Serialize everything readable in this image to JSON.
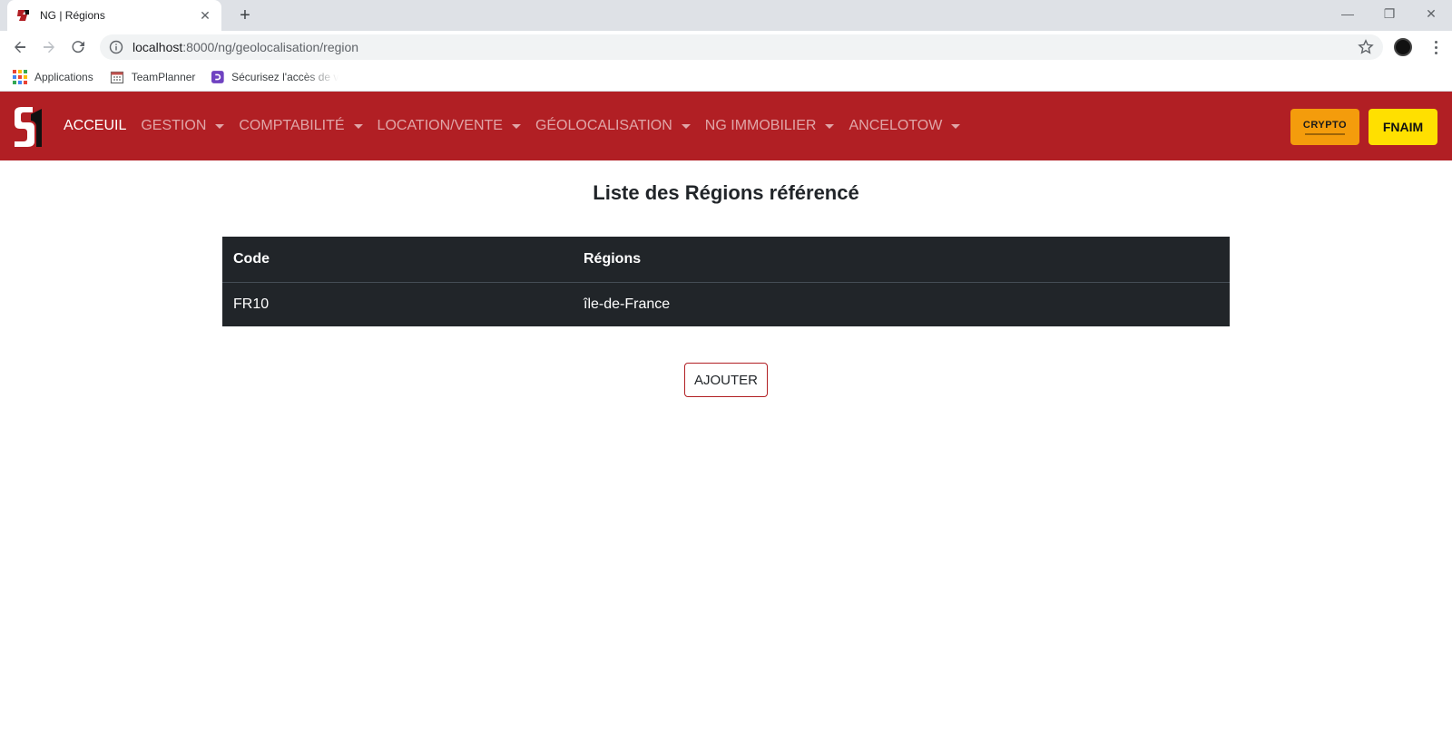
{
  "browser": {
    "tab_title": "NG | Régions",
    "tab_close": "✕",
    "new_tab": "+",
    "url_host": "localhost",
    "url_rest": ":8000/ng/geolocalisation/region",
    "bookmarks": [
      "Applications",
      "TeamPlanner",
      "Sécurisez l'accès de v"
    ],
    "window_controls": {
      "minimize": "—",
      "restore": "❐",
      "close": "✕"
    }
  },
  "navbar": {
    "items": [
      {
        "label": "ACCEUIL",
        "active": true,
        "dropdown": false
      },
      {
        "label": "GESTION",
        "active": false,
        "dropdown": true
      },
      {
        "label": "COMPTABILITÉ",
        "active": false,
        "dropdown": true
      },
      {
        "label": "LOCATION/VENTE",
        "active": false,
        "dropdown": true
      },
      {
        "label": "GÉOLOCALISATION",
        "active": false,
        "dropdown": true
      },
      {
        "label": "NG IMMOBILIER",
        "active": false,
        "dropdown": true
      },
      {
        "label": "ANCELOTOW",
        "active": false,
        "dropdown": true
      }
    ],
    "crypto_label": "CRYPTO",
    "fnaim_label": "FNAIM",
    "colors": {
      "navbar_bg": "#b11f24",
      "crypto_bg": "#f49c0c",
      "fnaim_bg": "#ffe000"
    }
  },
  "main": {
    "title": "Liste des Régions référencé",
    "table": {
      "headers": [
        "Code",
        "Régions"
      ],
      "rows": [
        [
          "FR10",
          "île-de-France"
        ]
      ]
    },
    "add_button": "AJOUTER"
  },
  "icons": [
    "back-arrow-icon",
    "forward-arrow-icon",
    "reload-icon",
    "info-icon",
    "star-icon",
    "apps-grid-icon",
    "calendar-icon",
    "bookmark-logo-icon",
    "kebab-menu-icon",
    "site-logo"
  ]
}
